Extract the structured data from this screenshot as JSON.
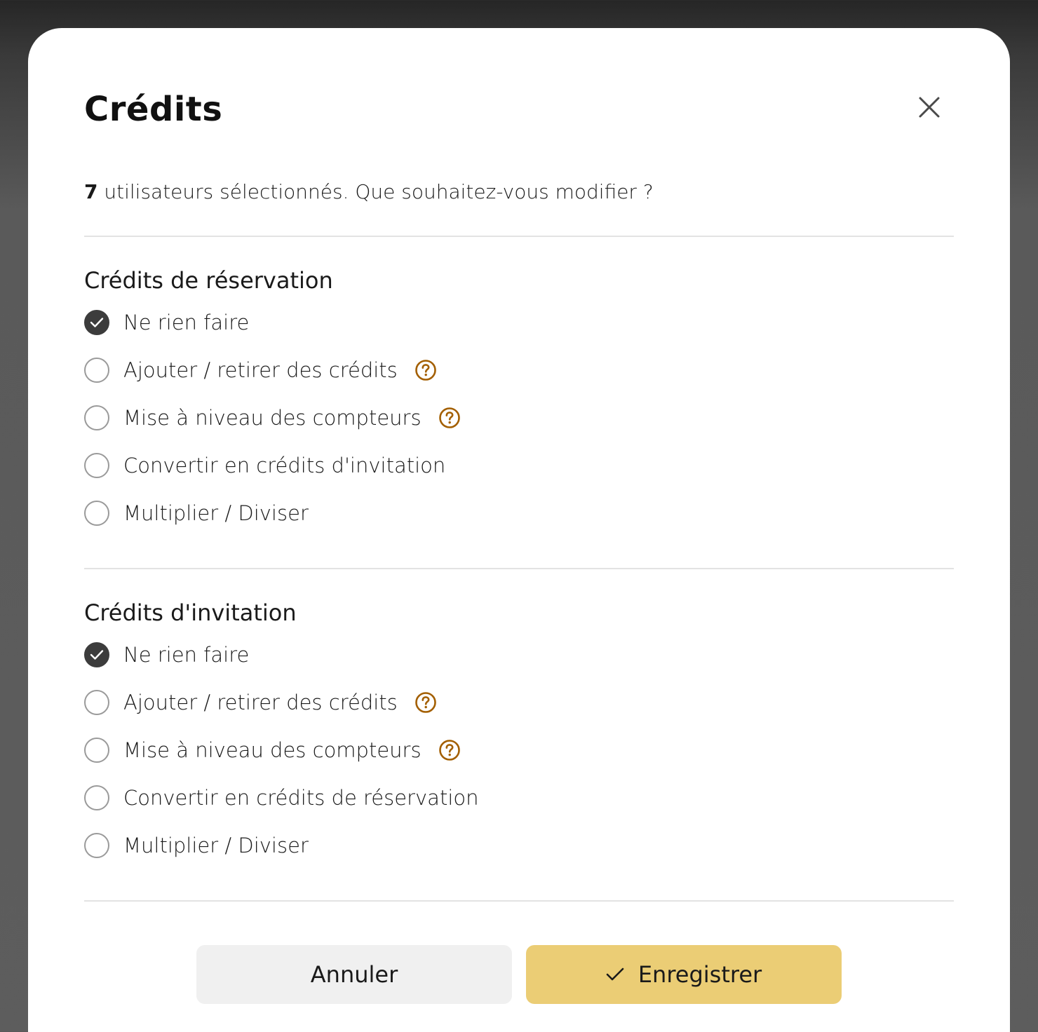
{
  "modal": {
    "title": "Crédits",
    "selected_count": "7",
    "subtitle_rest": " utilisateurs sélectionnés. Que souhaitez-vous modifier ?",
    "accent_color": "#ebcd75",
    "help_icon_color": "#a35f00",
    "close_icon": "close-icon"
  },
  "sections": [
    {
      "title": "Crédits de réservation",
      "options": [
        {
          "label": "Ne rien faire",
          "checked": true,
          "help": false
        },
        {
          "label": "Ajouter / retirer des crédits",
          "checked": false,
          "help": true
        },
        {
          "label": "Mise à niveau des compteurs",
          "checked": false,
          "help": true
        },
        {
          "label": "Convertir en crédits d'invitation",
          "checked": false,
          "help": false
        },
        {
          "label": "Multiplier / Diviser",
          "checked": false,
          "help": false
        }
      ]
    },
    {
      "title": "Crédits d'invitation",
      "options": [
        {
          "label": "Ne rien faire",
          "checked": true,
          "help": false
        },
        {
          "label": "Ajouter / retirer des crédits",
          "checked": false,
          "help": true
        },
        {
          "label": "Mise à niveau des compteurs",
          "checked": false,
          "help": true
        },
        {
          "label": "Convertir en crédits de réservation",
          "checked": false,
          "help": false
        },
        {
          "label": "Multiplier / Diviser",
          "checked": false,
          "help": false
        }
      ]
    }
  ],
  "footer": {
    "cancel_label": "Annuler",
    "save_label": "Enregistrer",
    "save_icon": "check-icon"
  }
}
